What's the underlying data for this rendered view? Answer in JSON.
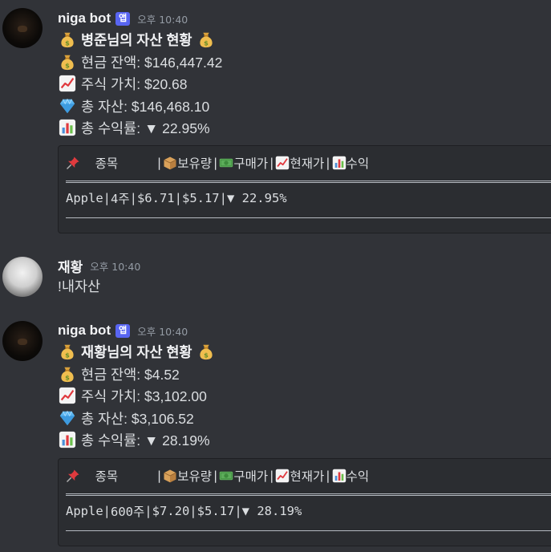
{
  "messages": [
    {
      "author": "niga bot",
      "app_tag": "앱",
      "timestamp": "오후 10:40",
      "title": "병준님의 자산 현황",
      "cash": "현금 잔액: $146,447.42",
      "stock": "주식 가치: $20.68",
      "total": "총 자산: $146,468.10",
      "return": "총 수익률: ▼ 22.95%",
      "table": {
        "headers": [
          "종목",
          "보유량",
          "구매가",
          "현재가",
          "수익"
        ],
        "row": {
          "name": "Apple",
          "qty": "4주",
          "buy": "6.71",
          "cur": "5.17",
          "ret": "▼ 22.95%"
        }
      }
    },
    {
      "author": "재황",
      "timestamp": "오후 10:40",
      "text": "!내자산"
    },
    {
      "author": "niga bot",
      "app_tag": "앱",
      "timestamp": "오후 10:40",
      "title": "재황님의 자산 현황",
      "cash": "현금 잔액: $4.52",
      "stock": "주식 가치: $3,102.00",
      "total": "총 자산: $3,106.52",
      "return": "총 수익률: ▼ 28.19%",
      "table": {
        "headers": [
          "종목",
          "보유량",
          "구매가",
          "현재가",
          "수익"
        ],
        "row": {
          "name": "Apple",
          "qty": "600주",
          "buy": "7.20",
          "cur": "5.17",
          "ret": "▼ 28.19%"
        }
      }
    }
  ],
  "table_sep": "|",
  "currency": "$",
  "icons": {
    "moneybag": "money-bag-icon",
    "chart_up": "chart-increasing-icon",
    "gem": "gem-icon",
    "bar_chart": "bar-chart-icon",
    "pin": "pushpin-icon",
    "package": "package-icon",
    "dollar": "dollar-banknote-icon"
  }
}
